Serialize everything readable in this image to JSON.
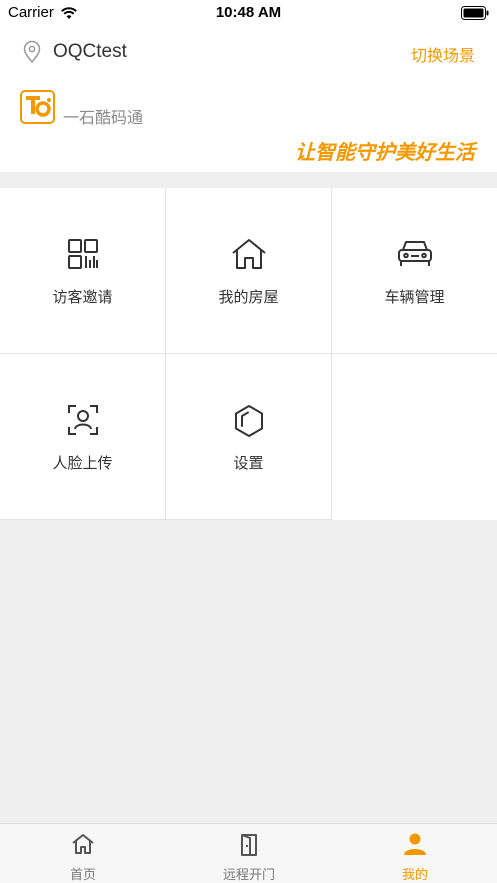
{
  "status_bar": {
    "carrier": "Carrier",
    "time": "10:48 AM"
  },
  "header": {
    "location_name": "OQCtest",
    "switch_scene_label": "切换场景",
    "brand_name": "一石酷码通",
    "slogan": "让智能守护美好生活"
  },
  "grid": {
    "items": [
      {
        "label": "访客邀请",
        "icon": "qr-code-icon"
      },
      {
        "label": "我的房屋",
        "icon": "house-icon"
      },
      {
        "label": "车辆管理",
        "icon": "car-icon"
      },
      {
        "label": "人脸上传",
        "icon": "face-scan-icon"
      },
      {
        "label": "设置",
        "icon": "hexagon-settings-icon"
      }
    ]
  },
  "tabbar": {
    "tabs": [
      {
        "label": "首页",
        "icon": "home-icon",
        "active": false
      },
      {
        "label": "远程开门",
        "icon": "door-icon",
        "active": false
      },
      {
        "label": "我的",
        "icon": "person-icon",
        "active": true
      }
    ]
  },
  "colors": {
    "accent": "#f39800",
    "text": "#333333",
    "background": "#efefef"
  }
}
